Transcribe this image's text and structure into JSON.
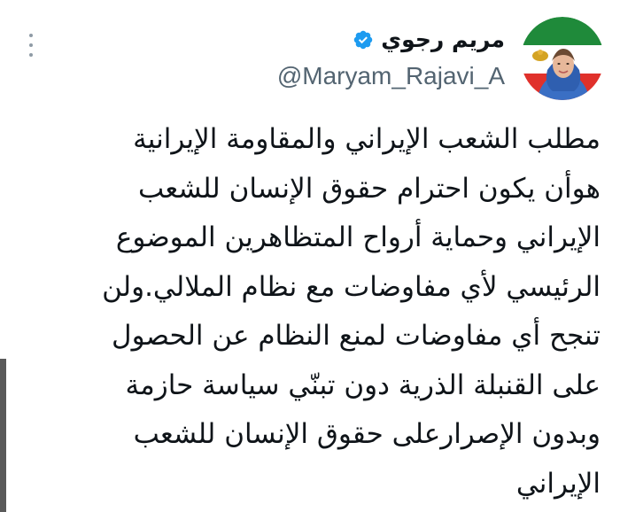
{
  "tweet": {
    "display_name": "مريم رجوي",
    "handle": "@Maryam_Rajavi_A",
    "verified": true,
    "text": "مطلب الشعب الإيراني والمقاومة الإيرانية\nهوأن يكون احترام حقوق الإنسان للشعب\nالإيراني وحماية أرواح المتظاهرين الموضوع\nالرئيسي لأي مفاوضات مع نظام الملالي.ولن\nتنجح أي مفاوضات لمنع النظام عن الحصول\nعلى القنبلة الذرية دون تبنّي سياسة حازمة\nوبدون الإصرارعلى حقوق الإنسان للشعب\nالإيراني"
  },
  "icons": {
    "verified": "verified-badge-icon",
    "more": "more-options-icon"
  },
  "colors": {
    "verified_blue": "#1d9bf0",
    "handle_gray": "#536471",
    "text": "#0f1419",
    "avatar_bg_top": "#1f8a3a",
    "avatar_bg_mid": "#ffffff",
    "avatar_bg_bottom": "#e0312b",
    "scarf_blue": "#3a6fc4"
  }
}
